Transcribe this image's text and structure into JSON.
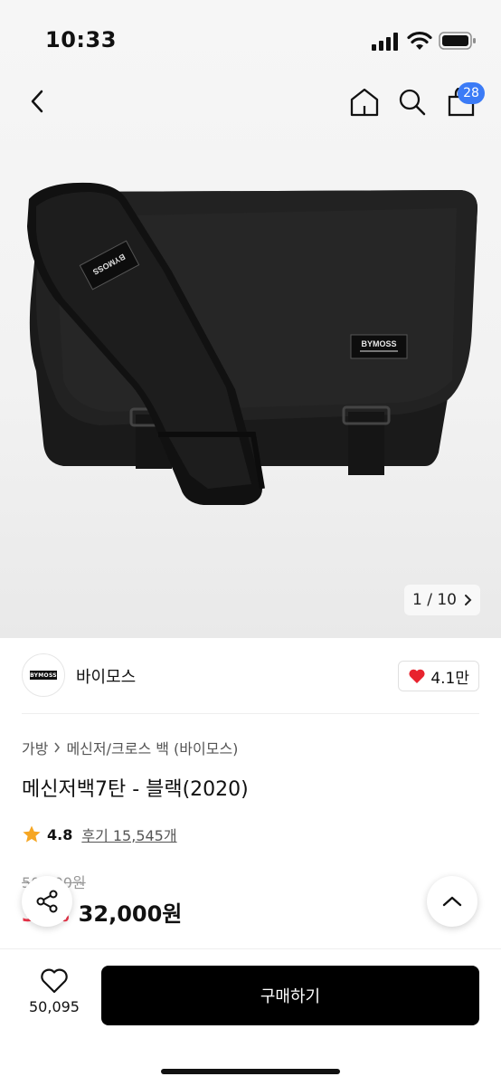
{
  "status_bar": {
    "time": "10:33"
  },
  "nav": {
    "cart_count": "28"
  },
  "gallery": {
    "pager": "1 / 10"
  },
  "product_image": {
    "logo_text": "BYMOSS"
  },
  "brand": {
    "name": "바이모스",
    "logo_text": "BYMOSS",
    "likes": "4.1만"
  },
  "breadcrumb": {
    "category": "가방",
    "subcategory": "메신저/크로스 백 (바이모스)"
  },
  "product": {
    "title": "메신저백7탄 - 블랙(2020)",
    "rating": "4.8",
    "reviews": "후기 15,545개",
    "original_price": "50,000원",
    "discount": "36%",
    "price": "32,000원"
  },
  "bottom": {
    "wish_count": "50,095",
    "buy_label": "구매하기"
  },
  "colors": {
    "badge": "#3b7bf6",
    "heart": "#e8232e",
    "star": "#f6a623",
    "discount": "#f0344a",
    "buy_button": "#000000"
  }
}
